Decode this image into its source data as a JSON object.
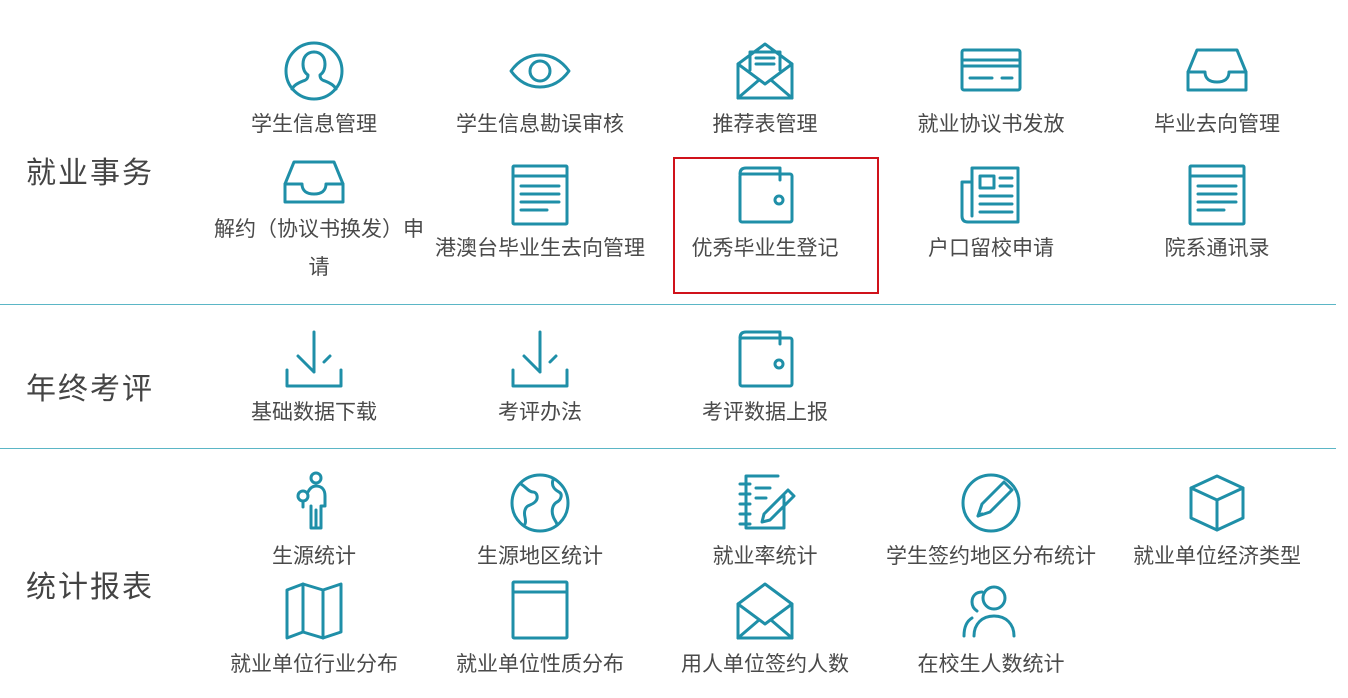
{
  "sections": [
    {
      "title": "就业事务",
      "items": [
        {
          "label": "学生信息管理",
          "icon": "user-avatar-icon"
        },
        {
          "label": "学生信息勘误审核",
          "icon": "eye-icon"
        },
        {
          "label": "推荐表管理",
          "icon": "envelope-letter-icon"
        },
        {
          "label": "就业协议书发放",
          "icon": "credit-card-icon"
        },
        {
          "label": "毕业去向管理",
          "icon": "inbox-tray-icon"
        },
        {
          "label": "解约（协议书换发）申请",
          "icon": "inbox-tray-icon"
        },
        {
          "label": "港澳台毕业生去向管理",
          "icon": "document-window-icon"
        },
        {
          "label": "优秀毕业生登记",
          "icon": "wallet-icon"
        },
        {
          "label": "户口留校申请",
          "icon": "newspaper-icon"
        },
        {
          "label": "院系通讯录",
          "icon": "document-window-icon"
        }
      ]
    },
    {
      "title": "年终考评",
      "items": [
        {
          "label": "基础数据下载",
          "icon": "download-icon"
        },
        {
          "label": "考评办法",
          "icon": "download-icon"
        },
        {
          "label": "考评数据上报",
          "icon": "wallet-icon"
        }
      ]
    },
    {
      "title": "统计报表",
      "items": [
        {
          "label": "生源统计",
          "icon": "person-pin-icon"
        },
        {
          "label": "生源地区统计",
          "icon": "globe-icon"
        },
        {
          "label": "就业率统计",
          "icon": "notebook-pen-icon"
        },
        {
          "label": "学生签约地区分布统计",
          "icon": "pencil-circle-icon"
        },
        {
          "label": "就业单位经济类型",
          "icon": "cube-icon"
        },
        {
          "label": "就业单位行业分布",
          "icon": "folded-map-icon"
        },
        {
          "label": "就业单位性质分布",
          "icon": "browser-window-icon"
        },
        {
          "label": "用人单位签约人数",
          "icon": "open-envelope-icon"
        },
        {
          "label": "在校生人数统计",
          "icon": "users-group-icon"
        }
      ]
    }
  ],
  "colors": {
    "accent": "#1f8fa8",
    "divider": "#5bb6c6",
    "highlight": "#d0121b",
    "text": "#4a4a4a"
  }
}
